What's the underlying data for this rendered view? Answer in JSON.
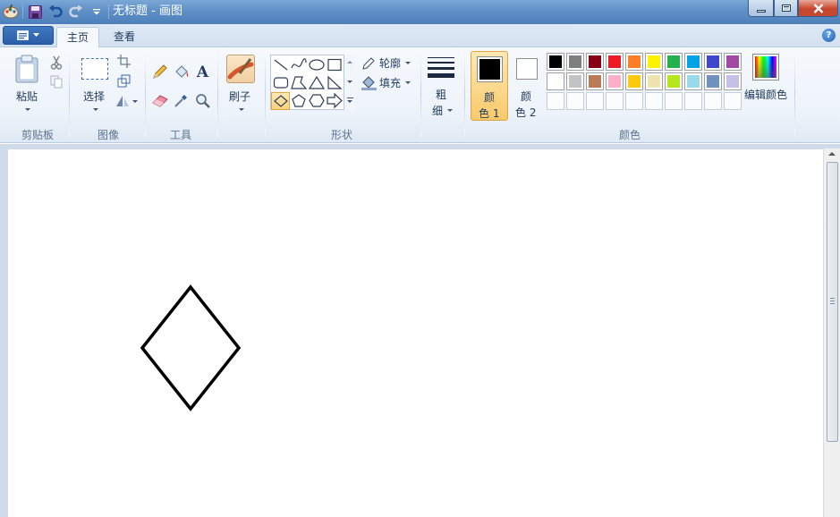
{
  "window": {
    "title": "无标题 - 画图",
    "buttons": {
      "minimize": "minimize-icon",
      "maximize": "maximize-icon",
      "close": "close-icon"
    }
  },
  "quick_access": [
    "paint-app-icon",
    "save-icon",
    "undo-icon",
    "redo-icon",
    "customize-dropdown-icon"
  ],
  "tabs": [
    {
      "label": "主页",
      "active": true
    },
    {
      "label": "查看",
      "active": false
    }
  ],
  "ribbon": {
    "clipboard": {
      "label": "剪贴板",
      "paste": "粘贴"
    },
    "image": {
      "label": "图像",
      "select": "选择"
    },
    "tools": {
      "label": "工具"
    },
    "brushes": {
      "label": "刷子"
    },
    "shapes": {
      "label": "形状",
      "outline": "轮廓",
      "fill": "填充",
      "selected_shape": "diamond"
    },
    "size": {
      "line1": "粗",
      "line2": "细"
    },
    "colors": {
      "label": "颜色",
      "color1": {
        "line1": "颜",
        "line2": "色 1",
        "value": "#000000"
      },
      "color2": {
        "line1": "颜",
        "line2": "色 2",
        "value": "#ffffff"
      },
      "edit": "编辑颜色",
      "palette_row1": [
        "#000000",
        "#7f7f7f",
        "#880015",
        "#ed1c24",
        "#ff7f27",
        "#fff200",
        "#22b14c",
        "#00a2e8",
        "#3f48cc",
        "#a349a4"
      ],
      "palette_row2": [
        "#ffffff",
        "#c3c3c3",
        "#b97a57",
        "#ffaec9",
        "#ffc90e",
        "#efe4b0",
        "#b5e61d",
        "#99d9ea",
        "#7092be",
        "#c8bfe7"
      ]
    }
  },
  "accent": "#f5c66b"
}
